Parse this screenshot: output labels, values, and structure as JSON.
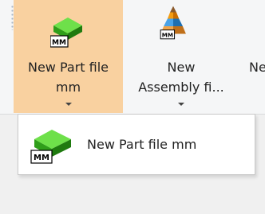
{
  "ribbon": {
    "new_part": {
      "icon": "part-mm-icon",
      "line1": "New Part file",
      "line2": "mm"
    },
    "new_assembly": {
      "icon": "assembly-mm-icon",
      "line1": "New",
      "line2": "Assembly fi..."
    },
    "truncated": "Ne"
  },
  "menu": {
    "items": [
      {
        "label": "New Part file mm",
        "icon": "part-mm-icon"
      }
    ]
  },
  "colors": {
    "active_button": "#f9d1a0",
    "part_green": "#35c21c",
    "assembly_orange": "#f39c12"
  }
}
